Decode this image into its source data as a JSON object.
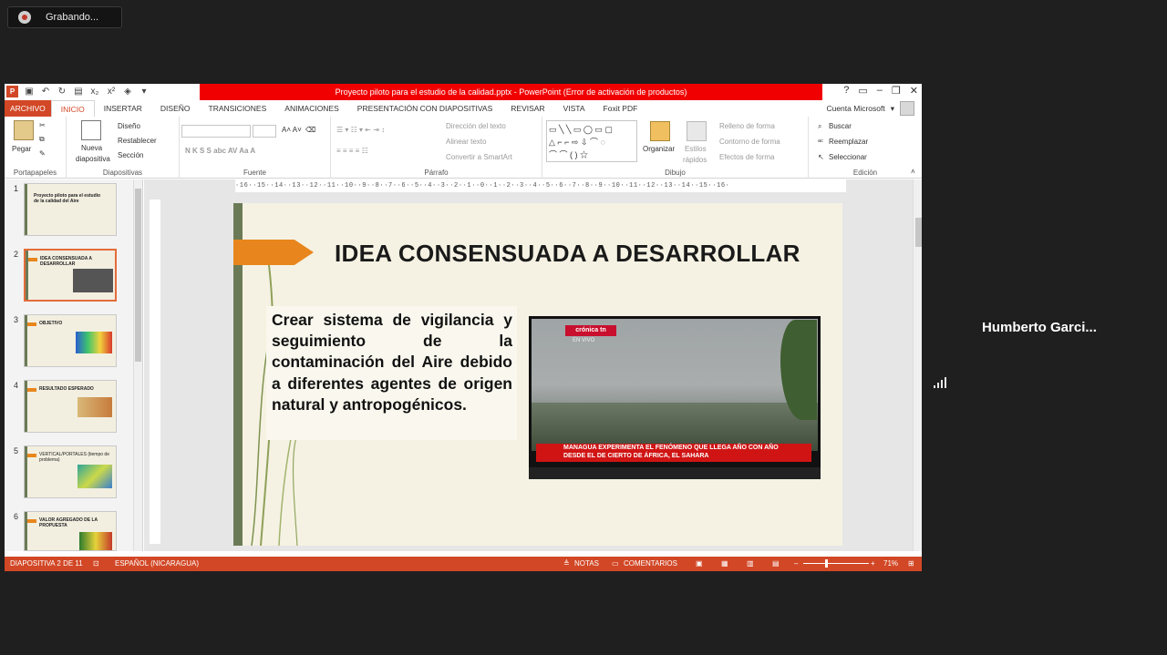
{
  "meeting": {
    "recording_label": "Grabando...",
    "participant_name": "Humberto Garci..."
  },
  "window": {
    "title": "Proyecto piloto para el estudio de la calidad.pptx - PowerPoint (Error de activación de productos)",
    "help": "?",
    "account_label": "Cuenta Microsoft"
  },
  "tabs": [
    {
      "label": "ARCHIVO"
    },
    {
      "label": "INICIO"
    },
    {
      "label": "INSERTAR"
    },
    {
      "label": "DISEÑO"
    },
    {
      "label": "TRANSICIONES"
    },
    {
      "label": "ANIMACIONES"
    },
    {
      "label": "PRESENTACIÓN CON DIAPOSITIVAS"
    },
    {
      "label": "REVISAR"
    },
    {
      "label": "VISTA"
    },
    {
      "label": "Foxit PDF"
    }
  ],
  "ribbon": {
    "portapapeles": {
      "label": "Portapapeles",
      "pegar": "Pegar"
    },
    "diapositivas": {
      "label": "Diapositivas",
      "nueva_1": "Nueva",
      "nueva_2": "diapositiva",
      "diseno": "Diseño",
      "restablecer": "Restablecer",
      "seccion": "Sección"
    },
    "fuente": {
      "label": "Fuente"
    },
    "parrafo": {
      "label": "Párrafo",
      "direccion": "Dirección del texto",
      "alinear": "Alinear texto",
      "smartart": "Convertir a SmartArt"
    },
    "dibujo": {
      "label": "Dibujo",
      "organizar": "Organizar",
      "estilos_1": "Estilos",
      "estilos_2": "rápidos",
      "relleno": "Relleno de forma",
      "contorno": "Contorno de forma",
      "efectos": "Efectos de forma"
    },
    "edicion": {
      "label": "Edición",
      "buscar": "Buscar",
      "reemplazar": "Reemplazar",
      "seleccionar": "Seleccionar"
    }
  },
  "thumbnails": [
    {
      "num": "1",
      "title": "Proyecto piloto para el estudio de la calidad del Aire"
    },
    {
      "num": "2",
      "title": "IDEA CONSENSUADA A DESARROLLAR"
    },
    {
      "num": "3",
      "title": "OBJETIVO"
    },
    {
      "num": "4",
      "title": "RESULTADO ESPERADO"
    },
    {
      "num": "5",
      "title": "VERTICAL/PORTALES (tiempo de problema)"
    },
    {
      "num": "6",
      "title": "VALOR AGREGADO DE LA PROPUESTA"
    }
  ],
  "ruler": {
    "horizontal": "·16··15··14··13··12··11··10··9··8··7··6··5··4··3··2··1··0··1··2··3··4··5··6··7··8··9··10··11··12··13··14··15··16·"
  },
  "slide": {
    "title": "IDEA CONSENSUADA A DESARROLLAR",
    "body": "Crear sistema de vigilancia y seguimiento de la contaminación del Aire debido a diferentes agentes de origen natural y antropogénicos.",
    "video": {
      "logo": "crónica tn",
      "live": "EN VIVO",
      "chyron_1": "MANAGUA EXPERIMENTA EL FENÓMENO QUE LLEGA AÑO CON AÑO",
      "chyron_2": "DESDE EL DE CIERTO DE ÁFRICA, EL SAHARA"
    }
  },
  "status": {
    "slide_pos": "DIAPOSITIVA 2 DE 11",
    "language": "ESPAÑOL (NICARAGUA)",
    "notes": "NOTAS",
    "comments": "COMENTARIOS",
    "zoom_percent": "71%"
  },
  "colors": {
    "accent": "#d24726",
    "title_bar_error": "#f00000",
    "slide_orange": "#e8861d",
    "slide_green": "#6b7a56"
  }
}
